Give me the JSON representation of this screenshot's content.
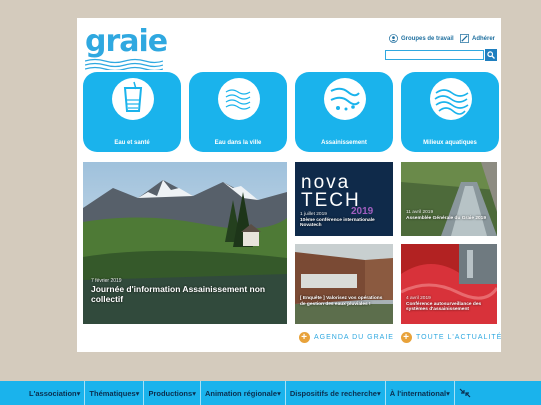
{
  "site": {
    "logo": "graie",
    "accent_color": "#1ab3ec",
    "dark_text_color": "#0b2f4f"
  },
  "header": {
    "links": [
      {
        "label": "Groupes de travail",
        "icon": "people-icon"
      },
      {
        "label": "Adhérer",
        "icon": "pencil-icon"
      }
    ],
    "search": {
      "placeholder": "",
      "button_icon": "search-icon"
    }
  },
  "themes": [
    {
      "label": "Eau et santé",
      "icon": "glass-icon"
    },
    {
      "label": "Eau dans la ville",
      "icon": "waterfall-icon"
    },
    {
      "label": "Assainissement",
      "icon": "pipe-icon"
    },
    {
      "label": "Milieux aquatiques",
      "icon": "wave-icon"
    }
  ],
  "news": {
    "featured": {
      "date": "7 février 2019",
      "title": "Journée d'information Assainissement non collectif"
    },
    "novatech": {
      "brand_line1": "nova",
      "brand_line2": "TECH",
      "year": "2019",
      "date": "1 juillet 2019",
      "title": "10ème conférence internationale Novatech"
    },
    "assembly": {
      "date": "11 avril 2019",
      "title": "Assemblée Générale du Graie 2019"
    },
    "survey": {
      "date": "",
      "title": "[ Enquête ] Valorisez vos opérations de gestion des eaux pluviales !"
    },
    "conference": {
      "date": "4 avril 2019",
      "title": "Conférence autosurveillance des systèmes d'assainissement"
    }
  },
  "footer_links": [
    {
      "label": "AGENDA DU GRAIE"
    },
    {
      "label": "TOUTE L'ACTUALITÉ"
    }
  ],
  "navbar": {
    "items": [
      {
        "label": "L'association"
      },
      {
        "label": "Thématiques"
      },
      {
        "label": "Productions"
      },
      {
        "label": "Animation régionale"
      },
      {
        "label": "Dispositifs de recherche"
      },
      {
        "label": "À l'international"
      }
    ],
    "collapse_icon": "collapse-arrows-icon"
  }
}
